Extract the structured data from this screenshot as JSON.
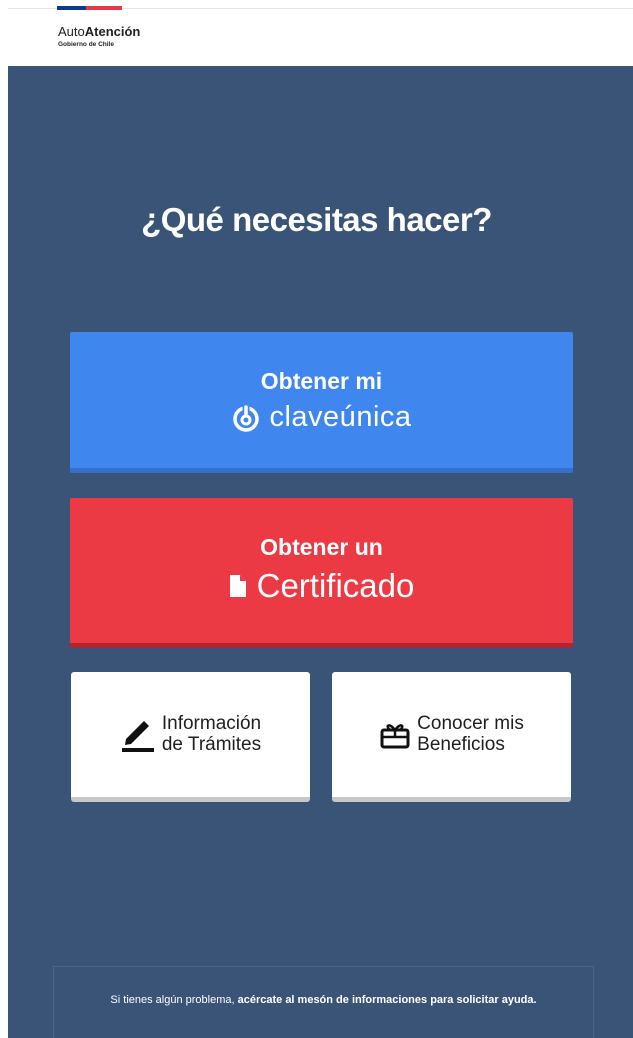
{
  "header": {
    "brand_light": "Auto",
    "brand_bold": "Atención",
    "subtitle": "Gobierno de Chile"
  },
  "main": {
    "title": "¿Qué necesitas hacer?",
    "clave_button": {
      "line1": "Obtener mi",
      "line2": "claveúnica",
      "icon": "power-icon",
      "color": "#3f87ee"
    },
    "cert_button": {
      "line1": "Obtener un",
      "line2": "Certificado",
      "icon": "document-icon",
      "color": "#ec3a45"
    },
    "tramites_button": {
      "line1": "Información",
      "line2": "de Trámites",
      "icon": "pencil-icon"
    },
    "beneficios_button": {
      "line1": "Conocer mis",
      "line2": "Beneficios",
      "icon": "gift-icon"
    }
  },
  "footer": {
    "text_regular": "Si tienes algún problema, ",
    "text_bold": "acércate al mesón de informaciones para solicitar ayuda."
  },
  "colors": {
    "background": "#3a5478",
    "flag_blue": "#0a3b8f",
    "flag_red": "#e63946"
  }
}
